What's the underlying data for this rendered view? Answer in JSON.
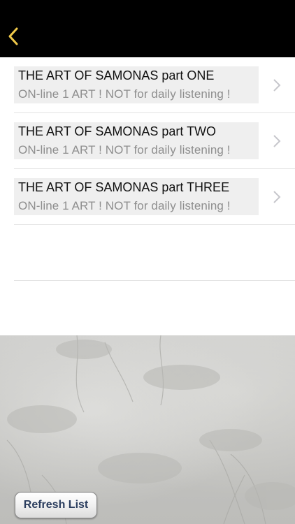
{
  "navbar": {
    "back_icon": "chevron-left-icon",
    "accent": "#f0c94a"
  },
  "items": [
    {
      "title": "THE ART OF SAMONAS part ONE",
      "subtitle": "ON-line   1  ART ! NOT for daily listening !"
    },
    {
      "title": "THE ART OF SAMONAS part TWO",
      "subtitle": "ON-line   1  ART ! NOT for daily listening !"
    },
    {
      "title": "THE ART OF SAMONAS part THREE",
      "subtitle": "ON-line   1  ART ! NOT for daily listening !"
    }
  ],
  "footer": {
    "refresh_label": "Refresh List"
  }
}
